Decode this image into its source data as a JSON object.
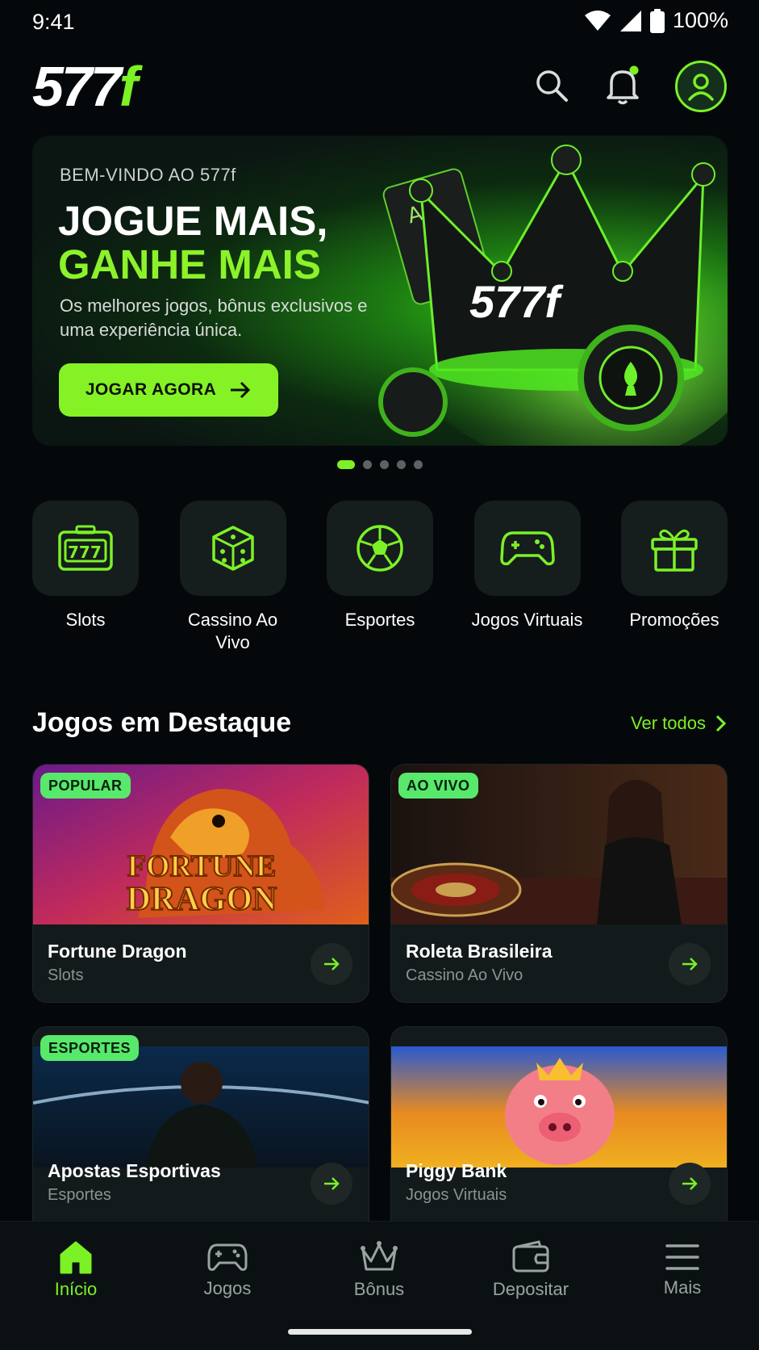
{
  "status_bar": {
    "time": "9:41",
    "battery": "100%"
  },
  "header": {
    "logo_main": "577",
    "logo_accent": "f"
  },
  "hero": {
    "eyebrow": "BEM-VINDO AO 577f",
    "title_line1": "JOGUE MAIS,",
    "title_line2": "GANHE MAIS",
    "subtitle": "Os melhores jogos, bônus exclusivos e uma experiência única.",
    "cta_label": "JOGAR AGORA",
    "art_logo": "577f",
    "slides_total": 5,
    "active_slide": 1
  },
  "categories": [
    {
      "label": "Slots",
      "icon": "slot-machine-icon"
    },
    {
      "label": "Cassino Ao Vivo",
      "icon": "dice-icon"
    },
    {
      "label": "Esportes",
      "icon": "soccer-ball-icon"
    },
    {
      "label": "Jogos Virtuais",
      "icon": "gamepad-icon"
    },
    {
      "label": "Promoções",
      "icon": "gift-icon"
    }
  ],
  "featured": {
    "title": "Jogos em Destaque",
    "see_all": "Ver todos",
    "games": [
      {
        "badge": "POPULAR",
        "name": "Fortune Dragon",
        "type": "Slots",
        "image_text_1": "FORTUNE",
        "image_text_2": "DRAGON"
      },
      {
        "badge": "AO VIVO",
        "name": "Roleta Brasileira",
        "type": "Cassino Ao Vivo"
      },
      {
        "badge": "ESPORTES",
        "name": "Apostas Esportivas",
        "type": "Esportes"
      },
      {
        "badge": "",
        "name": "Piggy Bank",
        "type": "Jogos Virtuais"
      }
    ]
  },
  "bottom_nav": [
    {
      "label": "Início",
      "icon": "home-icon",
      "active": true
    },
    {
      "label": "Jogos",
      "icon": "gamepad-icon",
      "active": false
    },
    {
      "label": "Bônus",
      "icon": "crown-icon",
      "active": false
    },
    {
      "label": "Depositar",
      "icon": "wallet-icon",
      "active": false
    },
    {
      "label": "Mais",
      "icon": "menu-icon",
      "active": false
    }
  ],
  "colors": {
    "accent": "#7cf126",
    "background": "#05080a",
    "card": "#131a1b",
    "badge": "#58e86b"
  }
}
